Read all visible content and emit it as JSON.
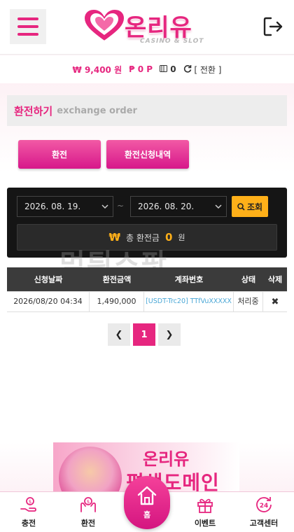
{
  "header": {
    "logo_text": "온리유",
    "logo_sub": "CASINO & SLOT"
  },
  "balance": {
    "money_symbol": "₩",
    "money": "9,400 원",
    "point_symbol": "₱",
    "point": "0 P",
    "coupon": "0",
    "exchange_label": "[ 전환 ]"
  },
  "page": {
    "title_ko": "환전하기",
    "title_en": "exchange order"
  },
  "tabs": [
    {
      "label": "환전"
    },
    {
      "label": "환전신청내역"
    }
  ],
  "filter": {
    "date_from": "2026. 08. 19.",
    "date_to": "2026. 08. 20.",
    "tilde": "~",
    "search_label": "조회",
    "total_symbol": "₩",
    "total_label": "총 환전금",
    "total_value": "0",
    "total_unit": "원"
  },
  "watermark": "먹튀스팟",
  "table": {
    "headers": [
      "신청날짜",
      "환전금액",
      "계좌번호",
      "상태",
      "삭제"
    ],
    "rows": [
      {
        "date": "2026/08/20 04:34",
        "amount": "1,490,000",
        "account": "[USDT-Trc20] TTfVuXXXXX",
        "status": "처리중",
        "delete": "✖"
      }
    ]
  },
  "pagination": {
    "prev": "❮",
    "current": "1",
    "next": "❯"
  },
  "banner": {
    "logo": "온리유",
    "text": "평생도메인"
  },
  "bottom_nav": [
    {
      "label": "충전",
      "icon": "deposit-icon"
    },
    {
      "label": "환전",
      "icon": "withdraw-icon"
    },
    {
      "label": "홈",
      "icon": "home-icon"
    },
    {
      "label": "이벤트",
      "icon": "gift-icon"
    },
    {
      "label": "고객센터",
      "icon": "support-24-icon"
    }
  ],
  "colors": {
    "accent": "#e6267f",
    "gold": "#ffb019",
    "dark": "#151515"
  }
}
